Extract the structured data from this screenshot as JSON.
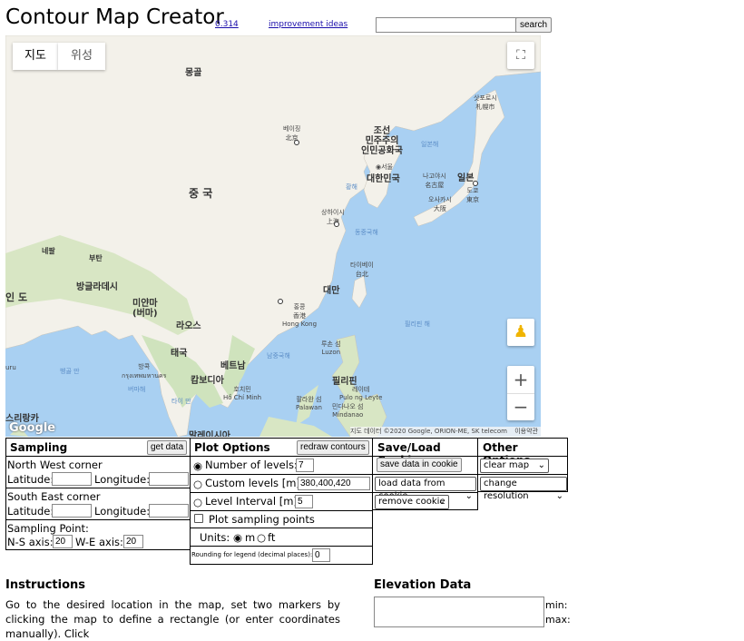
{
  "header": {
    "title": "Contour Map Creator",
    "version_link": "0.314",
    "ideas_link": "improvement ideas",
    "search_placeholder": "",
    "search_button": "search"
  },
  "map": {
    "type_buttons": [
      "지도",
      "위성"
    ],
    "labels": {
      "mongolia": "몽골",
      "china": "중 국",
      "beijing": "베이징\n北京",
      "nkorea": "조선\n민주주의\n인민공화국",
      "seoul": "◉서울",
      "skorea": "대한민국",
      "japan": "일본",
      "sapporo": "삿포로시\n札幌市",
      "nagoya": "나고야시\n名古屋",
      "osaka": "오사카시\n大阪",
      "tokyo": "도쿄\n東京",
      "shanghai": "상하이시\n上海",
      "taipei": "타이베이\n台北",
      "taiwan": "대만",
      "hongkong": "홍콩\n香港\nHong Kong",
      "myanmar": "미얀마\n(버마)",
      "laos": "라오스",
      "thailand": "태국",
      "bangkok": "방콕\nกรุงเทพมหานคร",
      "cambodia": "캄보디아",
      "vietnam": "베트남",
      "hcm": "호치민\nHồ Chí Minh",
      "philippines": "필리핀",
      "luzon": "루손 섬\nLuzon",
      "leyte": "레이테\nPulo ng Leyte",
      "palawan": "팔라완 섬\nPalawan",
      "mindanao": "민다나오 섬\nMindanao",
      "bangladesh": "방글라데시",
      "bhutan": "부탄",
      "nepal": "네팔",
      "india": "인 도",
      "srilanka": "스리랑카",
      "malaysia": "말레이시아",
      "yellow_sea": "황해",
      "east_china_sea": "동중국해",
      "east_sea": "일본해",
      "south_china_sea": "남중국해",
      "philippine_sea": "필리핀 해",
      "bay_bengal": "벵골 만",
      "burma_sea": "버마해",
      "gulf_thai": "타이 만",
      "ruru": "uru"
    },
    "attribution": "지도 데이터 ©2020 Google, ORION-ME, SK telecom",
    "terms": "이용약관",
    "google_logo": "Google",
    "zoom_in": "+",
    "zoom_out": "−"
  },
  "sampling": {
    "title": "Sampling",
    "get_data": "get data",
    "nw_corner": "North West corner",
    "se_corner": "South East corner",
    "latitude": "Latitude:",
    "longitude": "Longitude:",
    "nw_lat": "",
    "nw_lng": "",
    "se_lat": "",
    "se_lng": "",
    "sampling_point": "Sampling Point:",
    "ns_axis": "N-S axis:",
    "ns_value": "20",
    "we_axis": "W-E axis:",
    "we_value": "20"
  },
  "plot": {
    "title": "Plot Options",
    "redraw": "redraw contours",
    "num_levels": "Number of levels:",
    "num_levels_value": "7",
    "custom_levels": "Custom levels [m]:",
    "custom_levels_value": "380,400,420",
    "level_interval": "Level Interval [m]:",
    "level_interval_value": "5",
    "plot_points": "Plot sampling points",
    "units": "Units:",
    "unit_m": "m",
    "unit_ft": "ft",
    "rounding": "Rounding for legend (decimal places):",
    "rounding_value": "0"
  },
  "cookie": {
    "title": "Save/Load Cookie",
    "save": "save data in cookie",
    "load": "load data from cookie",
    "remove": "remove cookie"
  },
  "other": {
    "title": "Other Options",
    "clear_map": "clear map",
    "change_resolution": "change resolution"
  },
  "instructions": {
    "title": "Instructions",
    "text": "Go to the desired location in the map, set two markers by clicking the map to define a rectangle (or enter coordinates manually). Click"
  },
  "elevation": {
    "title": "Elevation Data",
    "min": "min:",
    "max": "max:"
  },
  "colors": {
    "water": "#a9d0f2",
    "land": "#f3f1ea",
    "land_green": "#cfe3bd",
    "link": "#1a0dab"
  }
}
